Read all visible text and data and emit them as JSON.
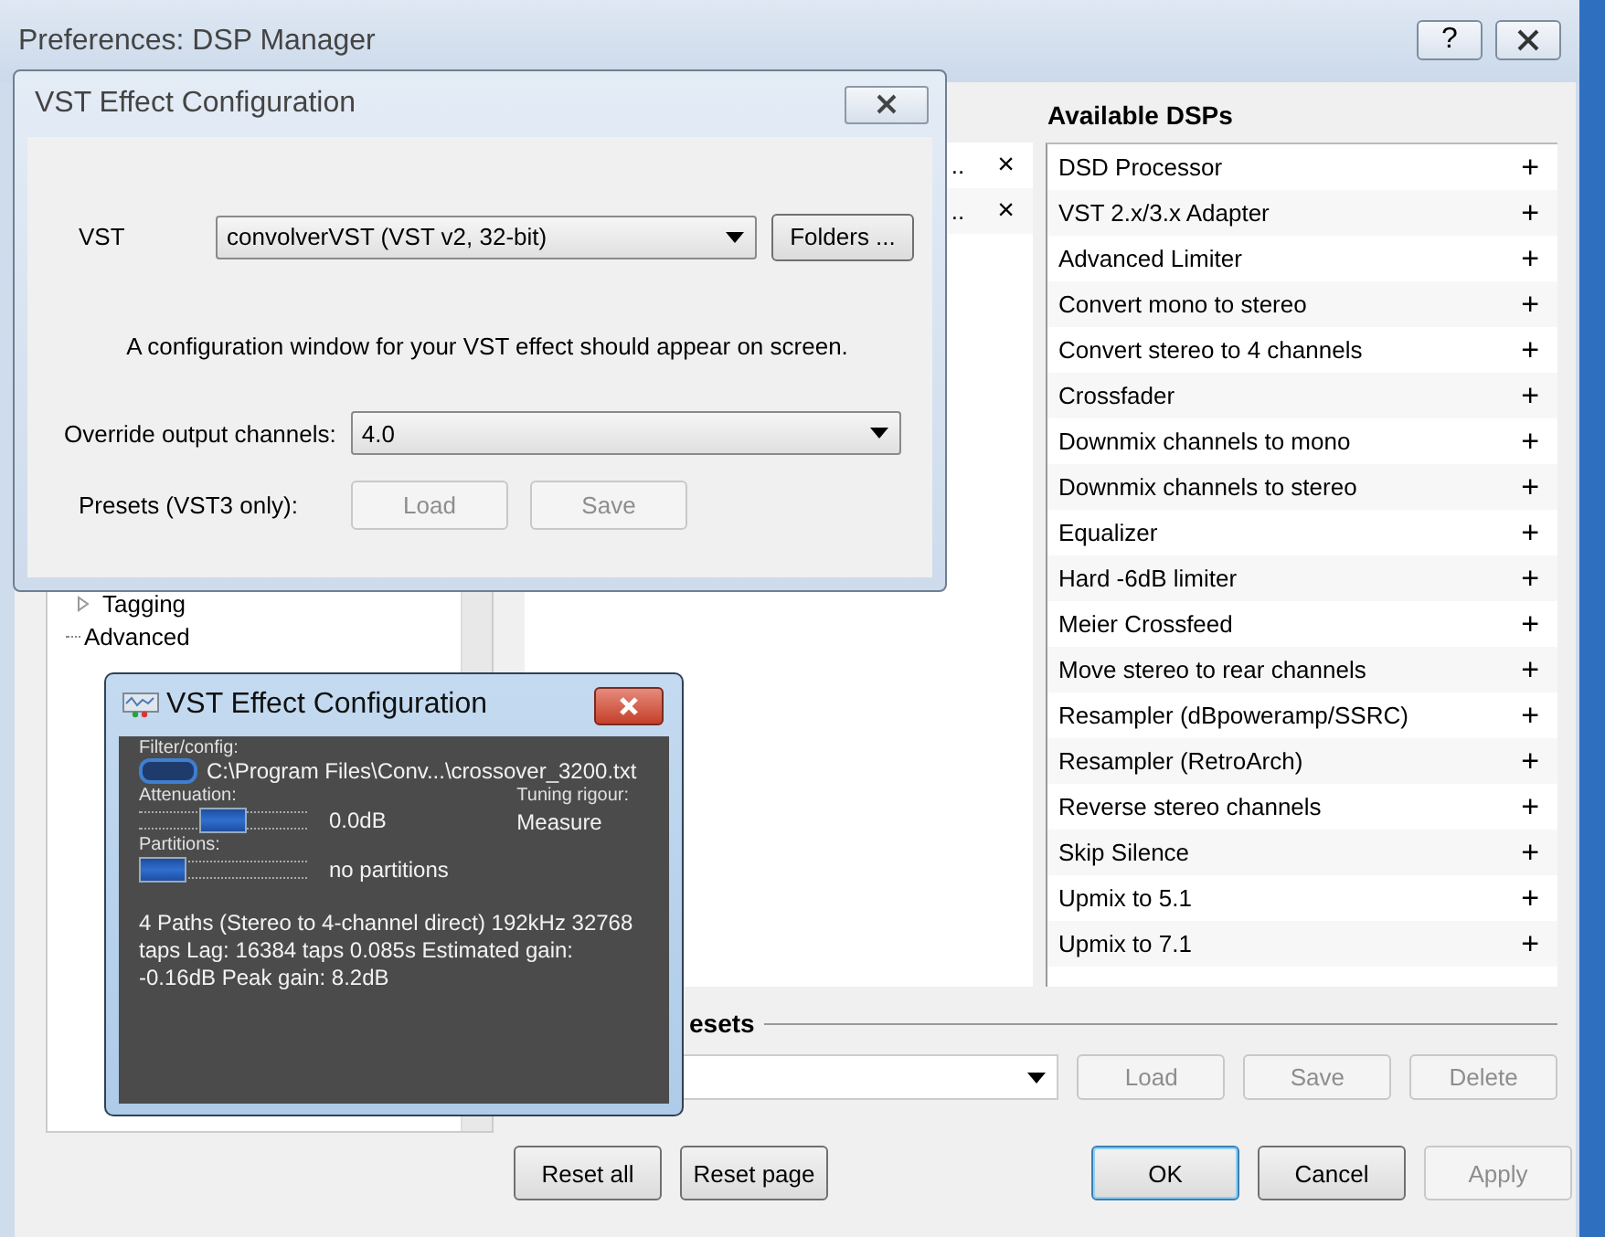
{
  "window": {
    "title": "Preferences: DSP Manager",
    "help": "?"
  },
  "tree": [
    {
      "label": "Tagging",
      "kind": "collapsed"
    },
    {
      "label": "Advanced",
      "kind": "leaf"
    }
  ],
  "active_dsps": [
    {
      "label": "..",
      "remove": "×"
    },
    {
      "label": "..",
      "remove": "×"
    }
  ],
  "available_dsps": {
    "title": "Available DSPs",
    "items": [
      {
        "label": "DSD Processor",
        "add": "+"
      },
      {
        "label": "VST 2.x/3.x Adapter",
        "add": "+"
      },
      {
        "label": "Advanced Limiter",
        "add": "+"
      },
      {
        "label": "Convert mono to stereo",
        "add": "+"
      },
      {
        "label": "Convert stereo to 4 channels",
        "add": "+"
      },
      {
        "label": "Crossfader",
        "add": "+"
      },
      {
        "label": "Downmix channels to mono",
        "add": "+"
      },
      {
        "label": "Downmix channels to stereo",
        "add": "+"
      },
      {
        "label": "Equalizer",
        "add": "+"
      },
      {
        "label": "Hard -6dB limiter",
        "add": "+"
      },
      {
        "label": "Meier Crossfeed",
        "add": "+"
      },
      {
        "label": "Move stereo to rear channels",
        "add": "+"
      },
      {
        "label": "Resampler (dBpoweramp/SSRC)",
        "add": "+"
      },
      {
        "label": "Resampler (RetroArch)",
        "add": "+"
      },
      {
        "label": "Reverse stereo channels",
        "add": "+"
      },
      {
        "label": "Skip Silence",
        "add": "+"
      },
      {
        "label": "Upmix to 5.1",
        "add": "+"
      },
      {
        "label": "Upmix to 7.1",
        "add": "+"
      }
    ]
  },
  "presets": {
    "title": "esets",
    "buttons": [
      {
        "label": "Load",
        "disabled": true
      },
      {
        "label": "Save",
        "disabled": true
      },
      {
        "label": "Delete",
        "disabled": true
      }
    ]
  },
  "footer": {
    "left": [
      {
        "label": "Reset all",
        "disabled": false,
        "default": false
      },
      {
        "label": "Reset page",
        "disabled": false,
        "default": false
      }
    ],
    "right": [
      {
        "label": "OK",
        "disabled": false,
        "default": true
      },
      {
        "label": "Cancel",
        "disabled": false,
        "default": false
      },
      {
        "label": "Apply",
        "disabled": true,
        "default": false
      }
    ]
  },
  "vst_dialog": {
    "title": "VST Effect Configuration",
    "vst_label": "VST",
    "vst_value": "convolverVST (VST v2, 32-bit)",
    "folders_button": "Folders ...",
    "message": "A configuration window for your VST effect should appear on screen.",
    "override_label": "Override output channels:",
    "override_value": "4.0",
    "presets_label": "Presets (VST3 only):",
    "buttons": [
      {
        "label": "Load",
        "disabled": true
      },
      {
        "label": "Save",
        "disabled": true
      }
    ]
  },
  "convolver_dialog": {
    "title": "VST Effect Configuration",
    "filter_label": "Filter/config:",
    "file": "C:\\Program Files\\Conv...\\crossover_3200.txt",
    "attenuation_label": "Attenuation:",
    "attenuation": {
      "level": 0.5
    },
    "attenuation_value": "0.0dB",
    "tuning_label": "Tuning rigour:",
    "tuning_value": "Measure",
    "partitions_label": "Partitions:",
    "partitions": {
      "level": 0
    },
    "partitions_value": "no partitions",
    "info": "4 Paths (Stereo to 4-channel direct) 192kHz 32768 taps Lag: 16384 taps 0.085s Estimated gain: -0.16dB Peak gain: 8.2dB"
  }
}
